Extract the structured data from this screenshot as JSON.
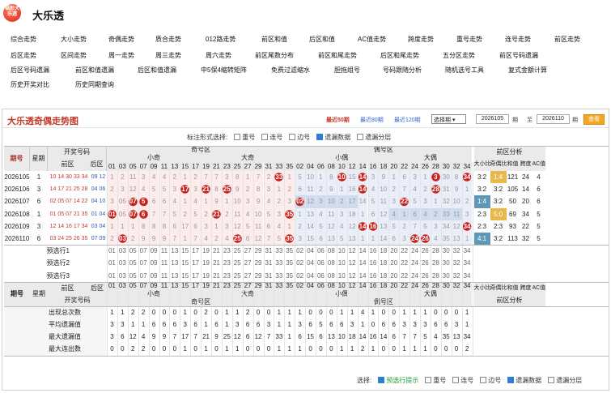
{
  "header": {
    "logo_text": "福彩大乐透",
    "title": "大乐透"
  },
  "nav": [
    [
      "综合走势",
      "大小走势",
      "奇偶走势",
      "质合走势",
      "012路走势",
      "前区和值",
      "后区和值",
      "AC值走势",
      "跨度走势",
      "重号走势",
      "连号走势",
      "前区走势"
    ],
    [
      "后区走势",
      "区间走势",
      "周一走势",
      "周三走势",
      "周六走势",
      "前区尾数分布",
      "前区和尾走势",
      "后区和尾走势",
      "五分区走势",
      "前区号码遗漏"
    ],
    [
      "后区号码遗漏",
      "前区和值遗漏",
      "后区和值遗漏",
      "中5保4缩转矩阵",
      "免费过滤缩水",
      "胆拖组号",
      "号码跟随分析",
      "随机选号工具",
      "复式金额计算"
    ],
    [
      "历史开奖对比",
      "历史同期查询"
    ]
  ],
  "panel": {
    "title": "大乐透奇偶走势图",
    "recent": [
      "最近50期",
      "最近80期",
      "最近120期"
    ],
    "select": "选择期",
    "from": "2026105",
    "to_label": "至",
    "to": "2026110",
    "period_unit": "期",
    "query_label": "查看"
  },
  "marker_label": "标注形式选择:",
  "markers": [
    {
      "label": "重号",
      "checked": false
    },
    {
      "label": "连号",
      "checked": false
    },
    {
      "label": "边号",
      "checked": false
    },
    {
      "label": "遗漏数据",
      "checked": true
    },
    {
      "label": "遗漏分层",
      "checked": false
    }
  ],
  "table": {
    "h_period": "期号",
    "h_week": "星期",
    "h_prize": "开奖号码",
    "h_front": "前区",
    "h_back": "后区",
    "h_odd": "奇号区",
    "h_even": "偶号区",
    "h_small_odd": "小奇",
    "h_big_odd": "大奇",
    "h_small_even": "小偶",
    "h_big_even": "大偶",
    "h_analysis": "前区分析",
    "a_cols": [
      "大小比",
      "奇偶比",
      "和值",
      "跨度",
      "AC值"
    ],
    "odd_nums": [
      "01",
      "03",
      "05",
      "07",
      "09",
      "11",
      "13",
      "15",
      "17",
      "19",
      "21",
      "23",
      "25",
      "27",
      "29",
      "31",
      "33",
      "35"
    ],
    "even_nums": [
      "02",
      "04",
      "06",
      "08",
      "10",
      "12",
      "14",
      "16",
      "18",
      "20",
      "22",
      "24",
      "26",
      "28",
      "30",
      "32",
      "34"
    ],
    "rows": [
      {
        "period": "2026105",
        "week": "1",
        "front": "10 14 30 33 34",
        "back": "09 12",
        "odd": [
          "1",
          "2",
          "11",
          "3",
          "4",
          "4",
          "2",
          "1",
          "2",
          "7",
          "7",
          "3",
          "8",
          "1",
          "7",
          "2",
          "33",
          "1"
        ],
        "even": [
          "5",
          "10",
          "1",
          "8",
          "10",
          "15",
          "14",
          "3",
          "9",
          "1",
          "6",
          "3",
          "1",
          "3",
          "30",
          "8",
          "34"
        ],
        "analysis": [
          "3:2",
          "1:4",
          "121",
          "24",
          "4"
        ]
      },
      {
        "period": "2026106",
        "week": "3",
        "front": "14 17 21 25 28",
        "back": "04 06",
        "odd": [
          "2",
          "3",
          "12",
          "4",
          "5",
          "5",
          "3",
          "17",
          "3",
          "21",
          "8",
          "25",
          "9",
          "2",
          "8",
          "3",
          "1",
          "2"
        ],
        "even": [
          "6",
          "11",
          "2",
          "9",
          "1",
          "16",
          "14",
          "4",
          "10",
          "2",
          "7",
          "4",
          "2",
          "28",
          "31",
          "9",
          "1"
        ],
        "analysis": [
          "3:2",
          "3:2",
          "105",
          "14",
          "6"
        ]
      },
      {
        "period": "2026107",
        "week": "6",
        "front": "02 05 07 14 22",
        "back": "04 10",
        "odd": [
          "3",
          "05",
          "07",
          "5",
          "6",
          "6",
          "4",
          "1",
          "4",
          "1",
          "9",
          "1",
          "10",
          "3",
          "9",
          "4",
          "2",
          "3"
        ],
        "even": [
          "02",
          "12",
          "3",
          "10",
          "2",
          "17",
          "14",
          "5",
          "11",
          "3",
          "22",
          "5",
          "3",
          "1",
          "32",
          "10",
          "2"
        ],
        "analysis": [
          "1:4",
          "3:2",
          "50",
          "20",
          "6"
        ]
      },
      {
        "period": "2026108",
        "week": "1",
        "front": "01 05 07 21 35",
        "back": "01 04",
        "odd": [
          "01",
          "05",
          "07",
          "6",
          "7",
          "7",
          "5",
          "2",
          "5",
          "2",
          "21",
          "2",
          "11",
          "4",
          "10",
          "5",
          "3",
          "35"
        ],
        "even": [
          "1",
          "13",
          "4",
          "11",
          "3",
          "18",
          "1",
          "6",
          "12",
          "4",
          "1",
          "6",
          "4",
          "2",
          "33",
          "11",
          "3"
        ],
        "analysis": [
          "2:3",
          "5:0",
          "69",
          "34",
          "5"
        ]
      },
      {
        "period": "2026109",
        "week": "3",
        "front": "12 14 16 17 34",
        "back": "03 04",
        "odd": [
          "1",
          "1",
          "1",
          "8",
          "8",
          "8",
          "6",
          "17",
          "6",
          "3",
          "1",
          "3",
          "12",
          "5",
          "11",
          "6",
          "4",
          "1"
        ],
        "even": [
          "2",
          "14",
          "5",
          "12",
          "4",
          "12",
          "14",
          "16",
          "13",
          "5",
          "2",
          "7",
          "5",
          "3",
          "34",
          "12",
          "34"
        ],
        "analysis": [
          "2:3",
          "2:3",
          "93",
          "22",
          "5"
        ]
      },
      {
        "period": "2026110",
        "week": "6",
        "front": "03 24 25 26 35",
        "back": "07 09",
        "odd": [
          "2",
          "03",
          "2",
          "9",
          "9",
          "9",
          "7",
          "1",
          "7",
          "4",
          "2",
          "4",
          "25",
          "6",
          "12",
          "7",
          "5",
          "35"
        ],
        "even": [
          "3",
          "15",
          "6",
          "13",
          "5",
          "13",
          "1",
          "1",
          "14",
          "6",
          "3",
          "24",
          "26",
          "4",
          "35",
          "13",
          "1"
        ],
        "analysis": [
          "4:1",
          "3:2",
          "113",
          "32",
          "5"
        ]
      }
    ],
    "pre_rows": [
      "预选行1",
      "预选行2",
      "预选行3"
    ],
    "stats": [
      {
        "label": "出现总次数",
        "odd": [
          "1",
          "1",
          "2",
          "2",
          "0",
          "0",
          "0",
          "1",
          "0",
          "2",
          "0",
          "1",
          "1",
          "2",
          "0",
          "0",
          "1",
          "1"
        ],
        "even": [
          "1",
          "0",
          "0",
          "0",
          "1",
          "1",
          "4",
          "1",
          "0",
          "0",
          "1",
          "1",
          "1",
          "0",
          "0",
          "0",
          "1"
        ]
      },
      {
        "label": "平均遗漏值",
        "odd": [
          "3",
          "3",
          "1",
          "1",
          "6",
          "6",
          "6",
          "3",
          "6",
          "1",
          "6",
          "1",
          "3",
          "6",
          "6",
          "3",
          "1",
          "1"
        ],
        "even": [
          "3",
          "6",
          "5",
          "6",
          "6",
          "3",
          "1",
          "0",
          "6",
          "6",
          "3",
          "3",
          "3",
          "6",
          "6",
          "3",
          "1"
        ]
      },
      {
        "label": "最大遗漏值",
        "odd": [
          "3",
          "6",
          "12",
          "4",
          "9",
          "9",
          "7",
          "17",
          "7",
          "21",
          "9",
          "25",
          "12",
          "6",
          "12",
          "7",
          "33",
          "1"
        ],
        "even": [
          "6",
          "15",
          "6",
          "13",
          "10",
          "18",
          "14",
          "16",
          "14",
          "6",
          "7",
          "7",
          "5",
          "4",
          "35",
          "13",
          "34"
        ]
      },
      {
        "label": "最大连出数",
        "odd": [
          "0",
          "0",
          "2",
          "2",
          "0",
          "0",
          "0",
          "1",
          "0",
          "1",
          "0",
          "1",
          "1",
          "0",
          "0",
          "0",
          "1",
          "1"
        ],
        "even": [
          "1",
          "0",
          "0",
          "0",
          "1",
          "1",
          "2",
          "1",
          "0",
          "0",
          "1",
          "1",
          "1",
          "0",
          "0",
          "0",
          "2"
        ]
      }
    ]
  },
  "footer": {
    "label": "选择:",
    "options": [
      {
        "label": "预选行提示",
        "checked": true,
        "green": true
      },
      {
        "label": "重号",
        "checked": false
      },
      {
        "label": "连号",
        "checked": false
      },
      {
        "label": "边号",
        "checked": false
      },
      {
        "label": "遗漏数据",
        "checked": true
      },
      {
        "label": "遗漏分层",
        "checked": false
      }
    ]
  },
  "colors": {
    "hit": "#c8201c",
    "odd_zone_bg": "#fdecec",
    "even_zone_bg": "#e9eef8",
    "blue_mark": "#7f9fc8",
    "analysis_tag": "#e9b84d",
    "analysis_tag_blue": "#5e98b8",
    "header_bg": "#eaeaea",
    "title": "#c0392b"
  }
}
